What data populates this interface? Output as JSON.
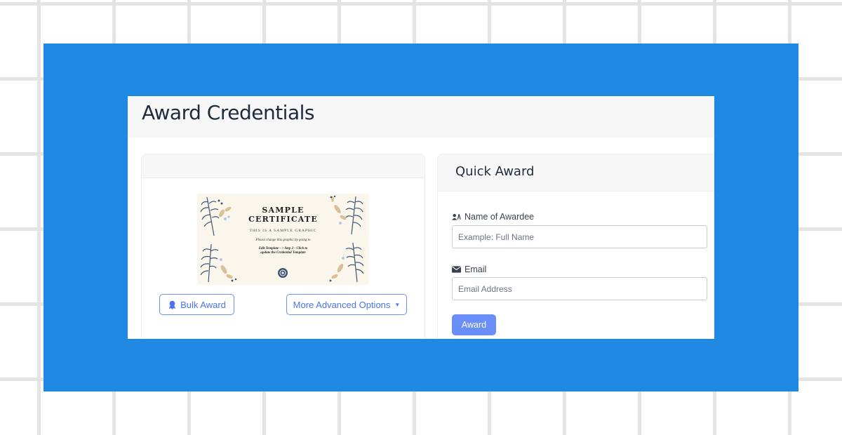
{
  "page": {
    "title": "Award Credentials"
  },
  "certificate": {
    "title_line1": "SAMPLE",
    "title_line2": "CERTIFICATE",
    "subtitle": "THIS IS A SAMPLE GRAPHIC",
    "line1": "Please change this graphic by going to",
    "line2": "Edit Template - > Step 2 - Click to",
    "line3": "update the Credential Template"
  },
  "left_card": {
    "bulk_award_label": "Bulk Award",
    "more_options_label": "More Advanced Options"
  },
  "quick_award": {
    "title": "Quick Award",
    "name_label": "Name of Awardee",
    "name_placeholder": "Example: Full Name",
    "email_label": "Email",
    "email_placeholder": "Email Address",
    "award_button": "Award"
  },
  "icons": {
    "bulk_award": "award-ribbon-icon",
    "name": "person-signature-icon",
    "email": "envelope-icon",
    "more_options": "caret-down-icon"
  },
  "colors": {
    "frame_blue": "#1f88e3",
    "primary_button": "#6a8ef7",
    "outline_button": "#4b74f0"
  }
}
